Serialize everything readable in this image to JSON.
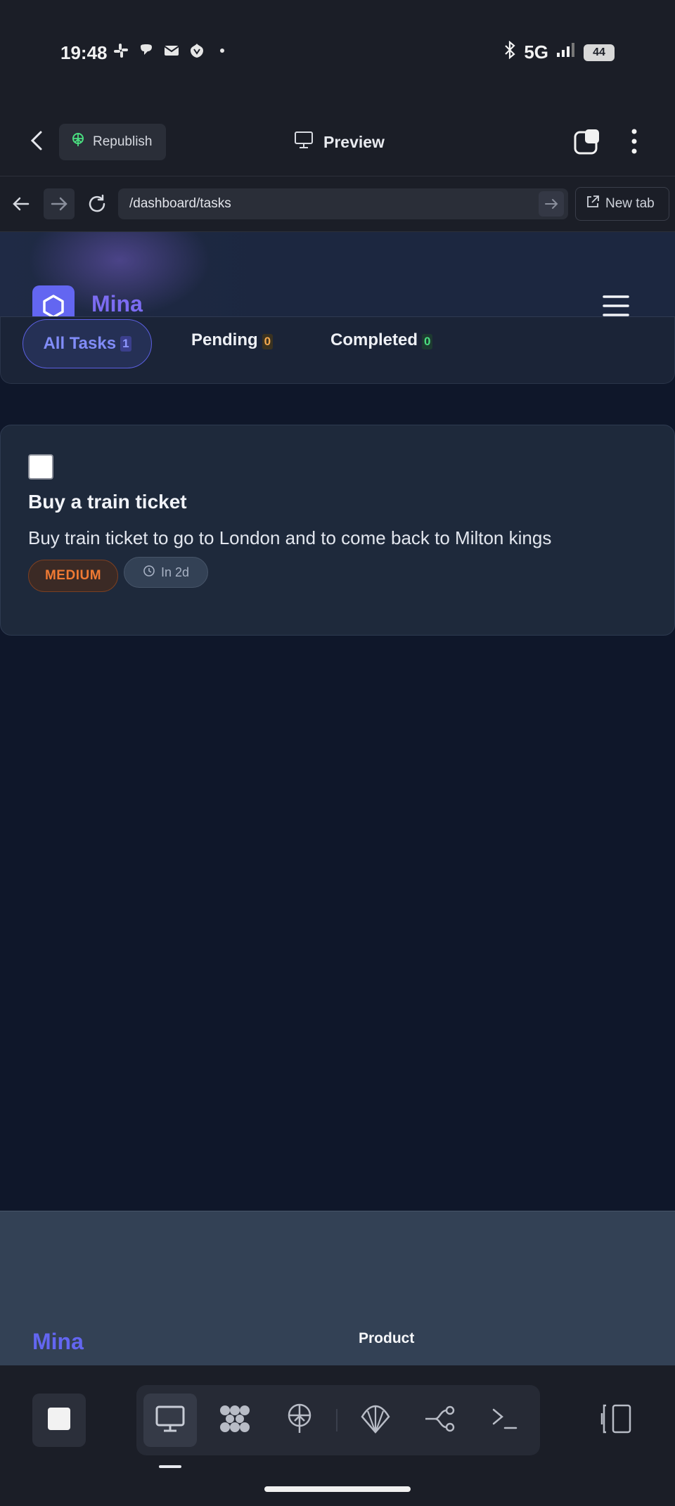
{
  "status_bar": {
    "time": "19:48",
    "network": "5G",
    "battery": "44",
    "icons": [
      "slack-icon",
      "chat-icon",
      "mail-icon",
      "bank-icon",
      "dot-icon",
      "bluetooth-icon",
      "signal-icon",
      "battery-icon"
    ]
  },
  "topbar": {
    "republish_label": "Republish",
    "preview_label": "Preview"
  },
  "browser": {
    "url": "/dashboard/tasks",
    "new_tab_label": "New tab"
  },
  "app": {
    "brand": "Mina",
    "accent_color": "#6366f1",
    "filters": [
      {
        "label": "All Tasks",
        "count": "1"
      },
      {
        "label": "Pending",
        "count": "0"
      },
      {
        "label": "Completed",
        "count": "0"
      }
    ],
    "tasks": [
      {
        "title": "Buy a train ticket",
        "description": "Buy train ticket to go to London and to come back to Milton kings",
        "priority": "MEDIUM",
        "due": "In 2d",
        "completed": false
      }
    ],
    "footer": {
      "brand": "Mina",
      "product_label": "Product"
    }
  },
  "toolbar": {
    "items": [
      "stop-icon",
      "desktop-icon",
      "apps-icon",
      "publish-icon",
      "shell-icon",
      "branch-icon",
      "terminal-icon",
      "panel-icon"
    ]
  }
}
